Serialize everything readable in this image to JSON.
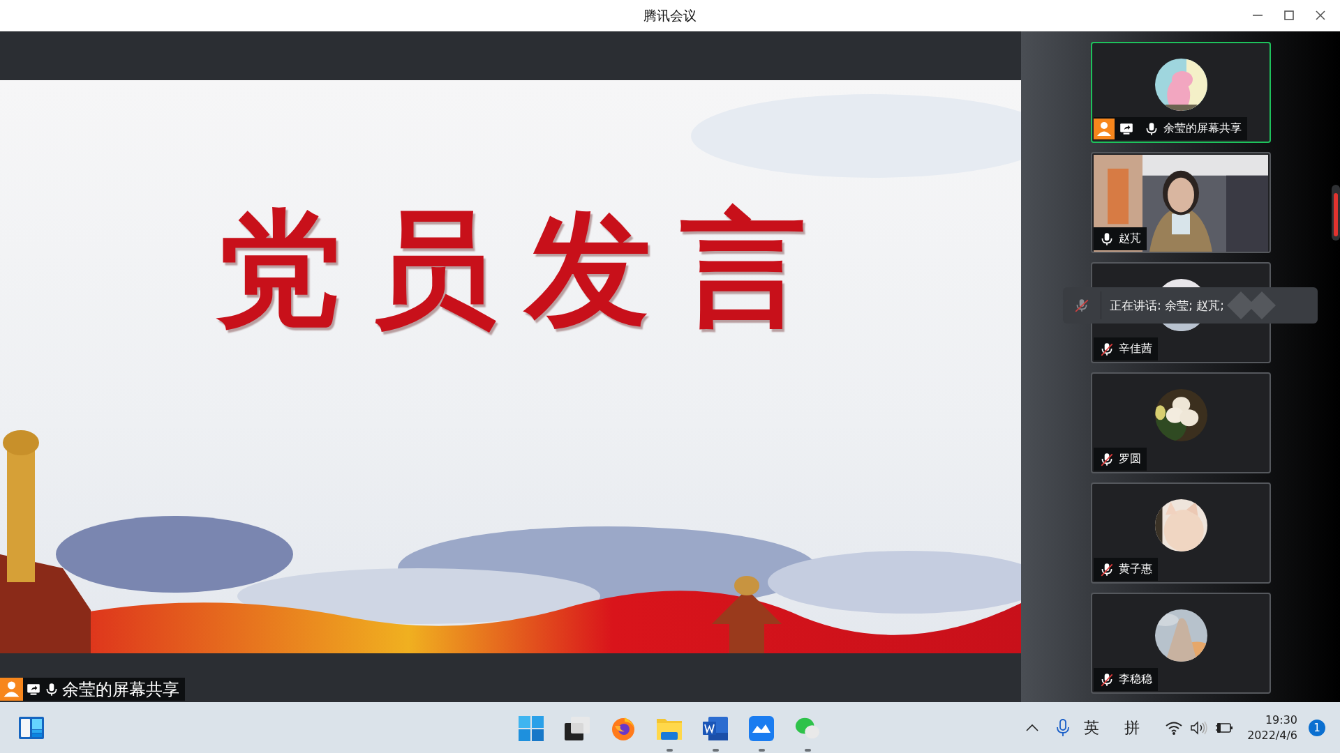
{
  "window": {
    "title": "腾讯会议"
  },
  "slide": {
    "title": "党员发言"
  },
  "share_label": {
    "name": "余莹的屏幕共享",
    "host": true,
    "sharing": true,
    "muted": false
  },
  "participants": [
    {
      "name": "余莹的屏幕共享",
      "kind": "avatar",
      "host": true,
      "sharing": true,
      "muted": false,
      "selected": true
    },
    {
      "name": "赵芃",
      "kind": "video",
      "host": false,
      "sharing": false,
      "muted": false,
      "selected": false
    },
    {
      "name": "辛佳茜",
      "kind": "avatar",
      "host": false,
      "sharing": false,
      "muted": true,
      "selected": false
    },
    {
      "name": "罗圆",
      "kind": "avatar",
      "host": false,
      "sharing": false,
      "muted": true,
      "selected": false
    },
    {
      "name": "黄子惠",
      "kind": "avatar",
      "host": false,
      "sharing": false,
      "muted": true,
      "selected": false
    },
    {
      "name": "李稳稳",
      "kind": "avatar",
      "host": false,
      "sharing": false,
      "muted": true,
      "selected": false
    }
  ],
  "speaking_toast": {
    "text": "正在讲话: 余莹; 赵芃;",
    "muted": true
  },
  "taskbar": {
    "apps": [
      {
        "kind": "start",
        "running": false
      },
      {
        "kind": "task_view",
        "running": false
      },
      {
        "kind": "browser",
        "running": false
      },
      {
        "kind": "files",
        "running": true
      },
      {
        "kind": "word",
        "running": true
      },
      {
        "kind": "meeting",
        "running": true
      },
      {
        "kind": "chat",
        "running": true
      }
    ],
    "tray": {
      "lang": "英",
      "ime": "拼",
      "time": "19:30",
      "date": "2022/4/6",
      "notifications": "1"
    }
  }
}
